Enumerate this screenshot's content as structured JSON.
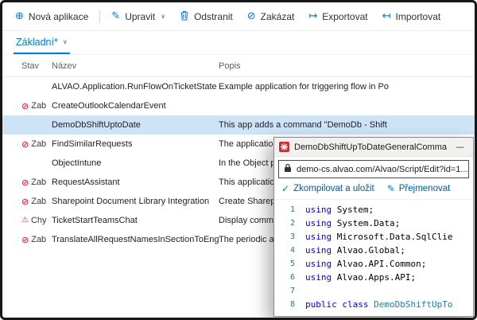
{
  "icons": {
    "add": "⊕",
    "edit": "✎",
    "block": "⊘",
    "export": "↦",
    "import": "↤",
    "chevron_down": "∨",
    "blocked": "⊘",
    "warning": "⚠",
    "check": "✓",
    "minimize": "—"
  },
  "colors": {
    "accent": "#0078d4",
    "selected_row": "#cde3f6",
    "status_error": "#c50f1f",
    "keyword_blue": "#0000ff",
    "type_teal": "#267f99"
  },
  "toolbar": {
    "items": [
      {
        "label": "Nová aplikace"
      },
      {
        "label": "Upravit"
      },
      {
        "label": "Odstranit"
      },
      {
        "label": "Zakázat"
      },
      {
        "label": "Exportovat"
      },
      {
        "label": "Importovat"
      }
    ]
  },
  "tab": {
    "label": "Základní*"
  },
  "table": {
    "columns": [
      "Stav",
      "Název",
      "Popis"
    ],
    "rows": [
      {
        "stav": "",
        "nazev": "ALVAO.Application.RunFlowOnTicketState",
        "popis": "Example application for triggering flow in Po"
      },
      {
        "stav": "Zab",
        "nazev": "CreateOutlookCalendarEvent",
        "popis": ""
      },
      {
        "stav": "",
        "nazev": "DemoDbShiftUptoDate",
        "popis": "This app adds a command \"DemoDb - Shift"
      },
      {
        "stav": "Zab",
        "nazev": "FindSimilarRequests",
        "popis": "The application"
      },
      {
        "stav": "",
        "nazev": "ObjectIntune",
        "popis": "In the Object p"
      },
      {
        "stav": "Zab",
        "nazev": "RequestAssistant",
        "popis": "This application"
      },
      {
        "stav": "Zab",
        "nazev": "Sharepoint Document Library Integration",
        "popis": "Create Sharepo"
      },
      {
        "stav": "Chy",
        "nazev": "TicketStartTeamsChat",
        "popis": "Display comma"
      },
      {
        "stav": "Zab",
        "nazev": "TranslateAllRequestNamesInSectionToEng",
        "popis": "The periodic ac"
      }
    ]
  },
  "popup": {
    "title": "DemoDbShiftUpToDateGeneralCommand...",
    "url": "demo-cs.alvao.com/Alvao/Script/Edit?id=1...",
    "actions": [
      {
        "label": "Zkompilovat a uložit"
      },
      {
        "label": "Přejmenovat"
      }
    ],
    "code": [
      {
        "n": "1",
        "kw": "using",
        "rest": " System;"
      },
      {
        "n": "2",
        "kw": "using",
        "rest": " System.Data;"
      },
      {
        "n": "3",
        "kw": "using",
        "rest": " Microsoft.Data.SqlClie"
      },
      {
        "n": "4",
        "kw": "using",
        "rest": " Alvao.Global;"
      },
      {
        "n": "5",
        "kw": "using",
        "rest": " Alvao.API.Common;"
      },
      {
        "n": "6",
        "kw": "using",
        "rest": " Alvao.Apps.API;"
      },
      {
        "n": "7",
        "kw": "",
        "rest": ""
      },
      {
        "n": "8",
        "kw": "public class",
        "type": " DemoDbShiftUpTo"
      }
    ]
  }
}
